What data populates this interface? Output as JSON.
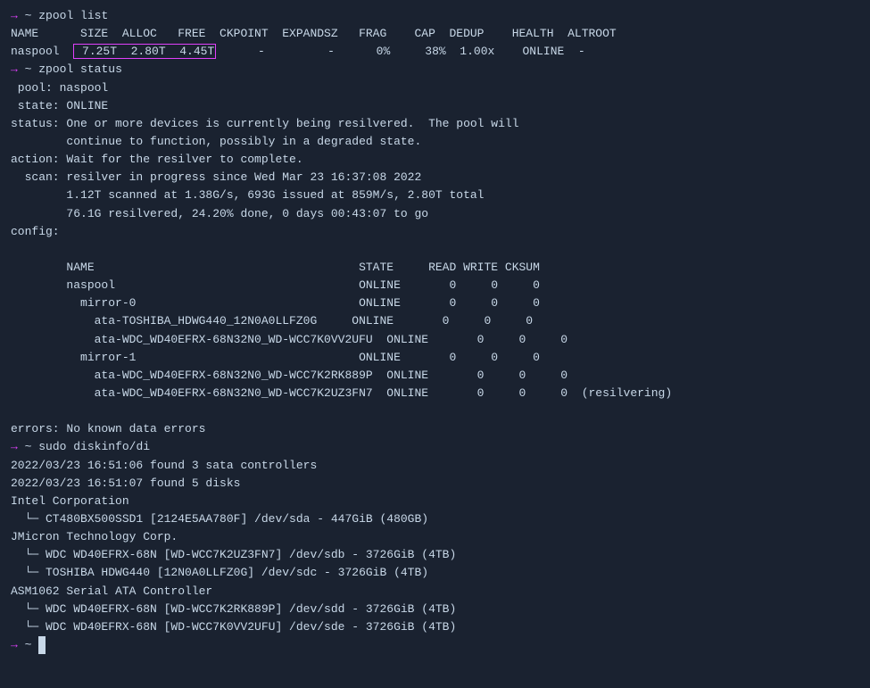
{
  "terminal": {
    "bg": "#1a2230",
    "fg": "#c8d8e8",
    "accent": "#e040fb",
    "lines": [
      {
        "type": "prompt",
        "cmd": "zpool list"
      },
      {
        "type": "output",
        "text": "NAME      SIZE  ALLOC   FREE  CKPOINT  EXPANDSZ   FRAG    CAP  DEDUP    HEALTH  ALTROOT"
      },
      {
        "type": "output_highlighted",
        "pre": "naspool  ",
        "highlighted": " 7.25T  2.80T  4.45T",
        "post": "      -         -      0%     38%  1.00x    ONLINE  -"
      },
      {
        "type": "prompt",
        "cmd": "zpool status"
      },
      {
        "type": "output",
        "text": " pool: naspool"
      },
      {
        "type": "output",
        "text": " state: ONLINE"
      },
      {
        "type": "output",
        "text": "status: One or more devices is currently being resilvered.  The pool will"
      },
      {
        "type": "output",
        "text": "        continue to function, possibly in a degraded state."
      },
      {
        "type": "output",
        "text": "action: Wait for the resilver to complete."
      },
      {
        "type": "output",
        "text": "  scan: resilver in progress since Wed Mar 23 16:37:08 2022"
      },
      {
        "type": "output",
        "text": "        1.12T scanned at 1.38G/s, 693G issued at 859M/s, 2.80T total"
      },
      {
        "type": "output",
        "text": "        76.1G resilvered, 24.20% done, 0 days 00:43:07 to go"
      },
      {
        "type": "output",
        "text": "config:"
      },
      {
        "type": "output",
        "text": ""
      },
      {
        "type": "output",
        "text": "\tNAME                                      STATE     READ WRITE CKSUM"
      },
      {
        "type": "output",
        "text": "\tnaspool                                   ONLINE       0     0     0"
      },
      {
        "type": "output",
        "text": "\t  mirror-0                                ONLINE       0     0     0"
      },
      {
        "type": "output",
        "text": "\t    ata-TOSHIBA_HDWG440_12N0A0LLFZ0G     ONLINE       0     0     0"
      },
      {
        "type": "output",
        "text": "\t    ata-WDC_WD40EFRX-68N32N0_WD-WCC7K0VV2UFU  ONLINE       0     0     0"
      },
      {
        "type": "output",
        "text": "\t  mirror-1                                ONLINE       0     0     0"
      },
      {
        "type": "output",
        "text": "\t    ata-WDC_WD40EFRX-68N32N0_WD-WCC7K2RK889P  ONLINE       0     0     0"
      },
      {
        "type": "output",
        "text": "\t    ata-WDC_WD40EFRX-68N32N0_WD-WCC7K2UZ3FN7  ONLINE       0     0     0  (resilvering)"
      },
      {
        "type": "output",
        "text": ""
      },
      {
        "type": "output",
        "text": "errors: No known data errors"
      },
      {
        "type": "prompt",
        "cmd": "sudo diskinfo/di"
      },
      {
        "type": "output",
        "text": "2022/03/23 16:51:06 found 3 sata controllers"
      },
      {
        "type": "output",
        "text": "2022/03/23 16:51:07 found 5 disks"
      },
      {
        "type": "output",
        "text": "Intel Corporation"
      },
      {
        "type": "output",
        "text": "  └─ CT480BX500SSD1 [2124E5AA780F] /dev/sda - 447GiB (480GB)"
      },
      {
        "type": "output",
        "text": "JMicron Technology Corp."
      },
      {
        "type": "output",
        "text": "  └─ WDC WD40EFRX-68N [WD-WCC7K2UZ3FN7] /dev/sdb - 3726GiB (4TB)"
      },
      {
        "type": "output",
        "text": "  └─ TOSHIBA HDWG440 [12N0A0LLFZ0G] /dev/sdc - 3726GiB (4TB)"
      },
      {
        "type": "output",
        "text": "ASM1062 Serial ATA Controller"
      },
      {
        "type": "output",
        "text": "  └─ WDC WD40EFRX-68N [WD-WCC7K2RK889P] /dev/sdd - 3726GiB (4TB)"
      },
      {
        "type": "output",
        "text": "  └─ WDC WD40EFRX-68N [WD-WCC7K0VV2UFU] /dev/sde - 3726GiB (4TB)"
      },
      {
        "type": "prompt_empty"
      }
    ]
  }
}
